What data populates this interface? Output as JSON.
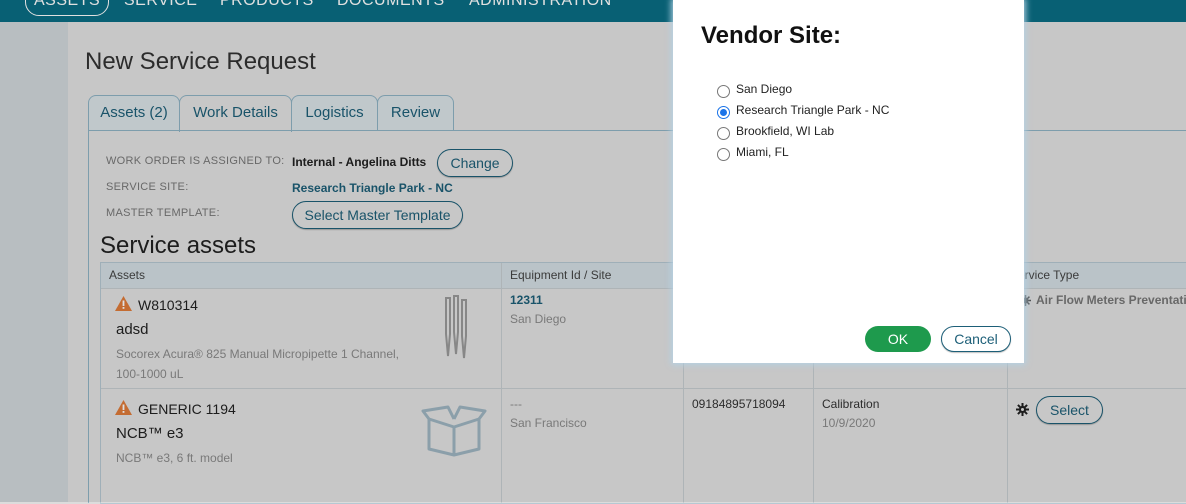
{
  "topnav": {
    "items": [
      "ASSETS",
      "SERVICE",
      "PRODUCTS",
      "DOCUMENTS",
      "ADMINISTRATION"
    ]
  },
  "page": {
    "title": "New Service Request"
  },
  "tabs": [
    "Assets (2)",
    "Work Details",
    "Logistics",
    "Review"
  ],
  "details": {
    "assigned_label": "WORK ORDER IS ASSIGNED TO:",
    "assigned_value": "Internal - Angelina Ditts",
    "change_button": "Change",
    "site_label": "SERVICE SITE:",
    "site_value": "Research Triangle Park - NC",
    "template_label": "MASTER TEMPLATE:",
    "template_button": "Select Master Template"
  },
  "section_title": "Service assets",
  "table": {
    "headers": [
      "Assets",
      "Equipment Id / Site",
      "",
      "",
      "ervice Type"
    ],
    "rows": [
      {
        "id": "W810314",
        "name": "adsd",
        "desc": "Socorex Acura® 825 Manual Micropipette 1 Channel, 100-1000 uL",
        "equip_id": "12311",
        "site": "San Diego",
        "service_type": "Air Flow Meters Preventativ",
        "image_icon": "pipette-icon"
      },
      {
        "id": "GENERIC 1194",
        "name": "NCB™ e3",
        "desc": "NCB™ e3, 6 ft. model",
        "equip_id": "---",
        "site": "San Francisco",
        "serial": "09184895718094",
        "service": "Calibration",
        "date": "10/9/2020",
        "select_button": "Select",
        "image_icon": "box-icon"
      }
    ]
  },
  "modal": {
    "title": "Vendor Site:",
    "options": [
      {
        "label": "San Diego",
        "checked": false
      },
      {
        "label": "Research Triangle Park - NC",
        "checked": true
      },
      {
        "label": "Brookfield, WI Lab",
        "checked": false
      },
      {
        "label": "Miami, FL",
        "checked": false
      }
    ],
    "ok_label": "OK",
    "cancel_label": "Cancel"
  },
  "colors": {
    "brand": "#0a6e85",
    "link": "#1d5f78",
    "ok": "#1e9a4d",
    "warn": "#e07b39",
    "radio": "#1a73e8"
  }
}
